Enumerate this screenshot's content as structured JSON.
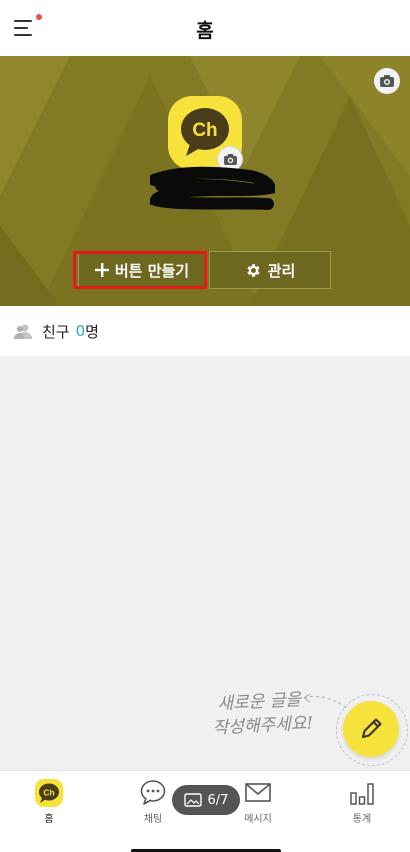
{
  "header": {
    "title": "홈",
    "menu_icon": "hamburger-menu-icon",
    "notification_dot_color": "#e8543d"
  },
  "profile": {
    "logo_text": "Ch",
    "logo_color": "#f7e23c",
    "banner_color": "#837a25",
    "create_button_label": "버튼 만들기",
    "manage_button_label": "관리"
  },
  "friends": {
    "label": "친구",
    "count": "0",
    "unit": "명",
    "count_color": "#2ea6c7"
  },
  "compose": {
    "hint_line1": "새로운 글을",
    "hint_line2": "작성해주세요!"
  },
  "tabs": [
    {
      "label": "홈",
      "icon": "home-ch-icon"
    },
    {
      "label": "채팅",
      "icon": "chat-bubble-icon"
    },
    {
      "label": "메시지",
      "icon": "envelope-icon"
    },
    {
      "label": "통계",
      "icon": "bar-chart-icon"
    }
  ],
  "pager": {
    "text": "6/7"
  }
}
